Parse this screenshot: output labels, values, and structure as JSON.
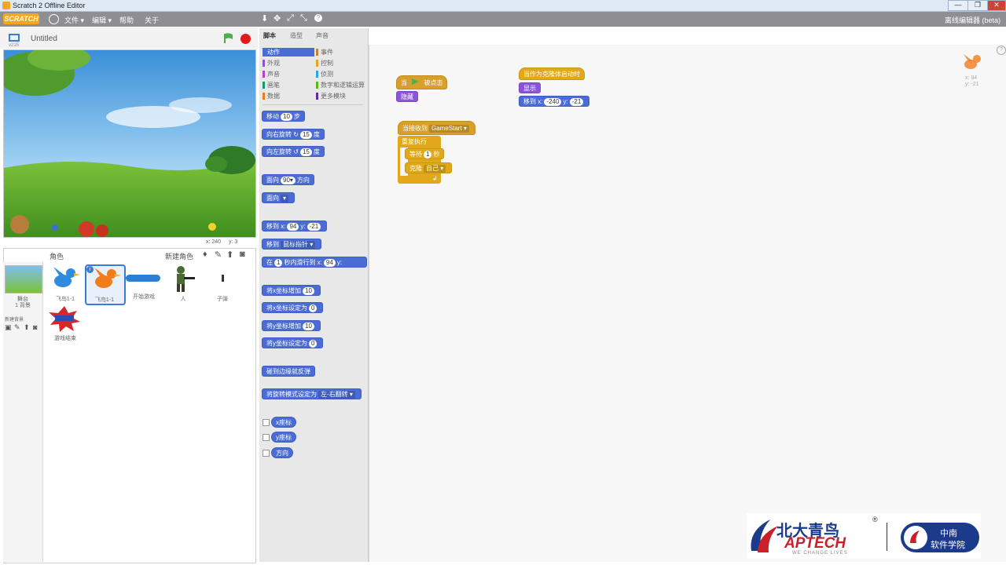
{
  "window": {
    "title": "Scratch 2 Offline Editor",
    "buttons": [
      "—",
      "❐",
      "✕"
    ]
  },
  "menubar": {
    "logo": "SCRATCH",
    "items": [
      "文件 ▾",
      "编辑 ▾",
      "帮助",
      "关于"
    ],
    "right_text": "离线编辑器 (beta)"
  },
  "stage": {
    "project_title": "Untitled",
    "version": "v215",
    "coords": {
      "x_label": "x: 240",
      "y_label": "y: 3"
    }
  },
  "sprites": {
    "header": "角色",
    "new_sprite_label": "新建角色",
    "stage_label": "舞台",
    "stage_sub": "1 背景",
    "new_backdrop": "新建背景",
    "items": [
      {
        "name": "飞鸟1-1",
        "color": "#2d8be0"
      },
      {
        "name": "飞鸟1-1",
        "color": "#f07c1c"
      },
      {
        "name": "开始游戏",
        "color": "#2a7fd6"
      },
      {
        "name": "人",
        "color": "#4b6b33"
      },
      {
        "name": "子弹",
        "color": "#333333"
      },
      {
        "name": "游戏结束",
        "color": "#d8262c"
      }
    ]
  },
  "tabs": [
    "脚本",
    "造型",
    "声音"
  ],
  "categories": {
    "left": [
      {
        "label": "动作",
        "color": "#4a6cd4",
        "active": true
      },
      {
        "label": "外观",
        "color": "#8a55d7"
      },
      {
        "label": "声音",
        "color": "#bb42c3"
      },
      {
        "label": "画笔",
        "color": "#0e9a6c"
      },
      {
        "label": "数据",
        "color": "#ee7d16"
      }
    ],
    "right": [
      {
        "label": "事件",
        "color": "#c88330"
      },
      {
        "label": "控制",
        "color": "#e1a91a"
      },
      {
        "label": "侦测",
        "color": "#2ca5e2"
      },
      {
        "label": "数字和逻辑运算",
        "color": "#5cb712"
      },
      {
        "label": "更多模块",
        "color": "#632d99"
      }
    ]
  },
  "palette": {
    "move": {
      "pre": "移动",
      "val": "10",
      "post": "步"
    },
    "turn_right": {
      "pre": "向右旋转",
      "icon": "↻",
      "val": "15",
      "post": "度"
    },
    "turn_left": {
      "pre": "向左旋转",
      "icon": "↺",
      "val": "15",
      "post": "度"
    },
    "point_dir": {
      "pre": "面向",
      "val": "90▾",
      "post": "方向"
    },
    "point_towards": {
      "pre": "面向",
      "val": "▾"
    },
    "goto_xy": {
      "pre": "移到 x:",
      "x": "94",
      "y_lbl": "y:",
      "y": "-21"
    },
    "goto": {
      "pre": "移到",
      "val": "鼠标指针 ▾"
    },
    "glide": {
      "pre": "在",
      "val": "1",
      "mid": "秒内滑行到 x:",
      "x": "94",
      "y_lbl": "y:"
    },
    "change_x": {
      "pre": "将x坐标增加",
      "val": "10"
    },
    "set_x": {
      "pre": "将x坐标设定为",
      "val": "0"
    },
    "change_y": {
      "pre": "将y坐标增加",
      "val": "10"
    },
    "set_y": {
      "pre": "将y坐标设定为",
      "val": "0"
    },
    "bounce": "碰到边缘就反弹",
    "rotation": {
      "pre": "将旋转模式设定为",
      "val": "左-右翻转 ▾"
    },
    "reporters": [
      "x座标",
      "y座标",
      "方向"
    ]
  },
  "scripts": {
    "s1": {
      "hat": "当",
      "hat_post": "被点击",
      "cmd": "隐藏"
    },
    "s2": {
      "hat": "当接收到",
      "msg": "GameStart ▾",
      "loop": "重复执行",
      "wait_pre": "等待",
      "wait_val": "1",
      "wait_post": "秒",
      "clone_pre": "克隆",
      "clone_val": "自己 ▾"
    },
    "s3": {
      "hat": "当作为克隆体启动时",
      "show": "显示",
      "goto_pre": "移到 x:",
      "x": "-240",
      "y_lbl": "y:",
      "y": "-21"
    },
    "sprite_info": {
      "x": "x: 94",
      "y": "y: -21"
    }
  },
  "banner": {
    "brand_cn": "北大青鸟",
    "brand_en": "APTECH",
    "tagline": "WE CHANGE LIVES",
    "school_1": "中南",
    "school_2": "软件学院"
  }
}
